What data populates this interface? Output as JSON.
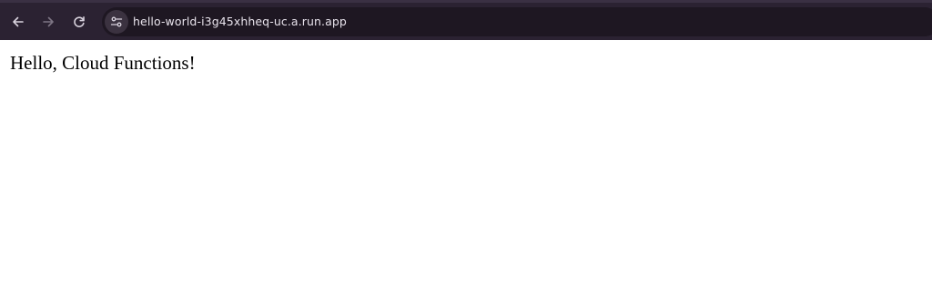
{
  "browser": {
    "url": "hello-world-i3g45xhheq-uc.a.run.app",
    "icons": {
      "back": "arrow-left-icon",
      "forward": "arrow-right-icon",
      "reload": "reload-icon",
      "site_info": "tune-icon"
    },
    "colors": {
      "toolbar": "#2b2232",
      "omnibox": "#1e1722",
      "icon": "#d9d3de",
      "icon_disabled": "#7d7584"
    }
  },
  "page": {
    "greeting": "Hello, Cloud Functions!"
  }
}
